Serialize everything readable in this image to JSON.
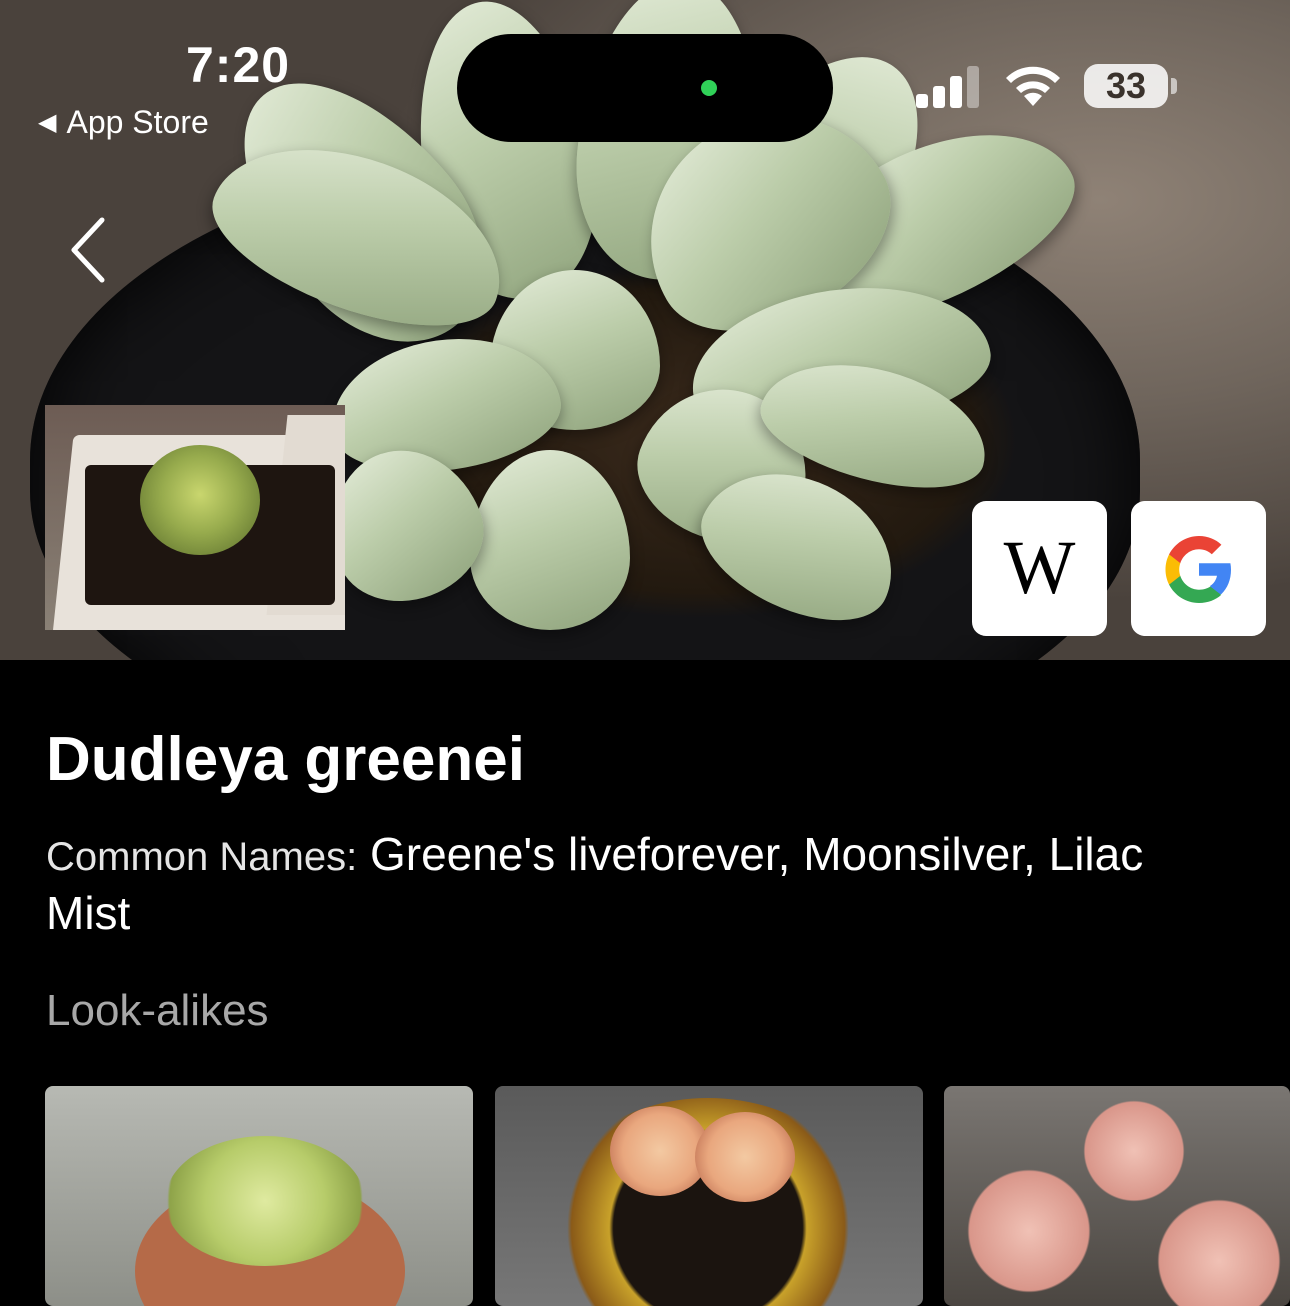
{
  "status_bar": {
    "time": "7:20",
    "back_app_label": "App Store",
    "battery_level": "33"
  },
  "hero": {
    "back_icon": "chevron-left-icon",
    "wikipedia_button_label": "W",
    "google_button_icon": "google-g-icon"
  },
  "plant": {
    "scientific_name": "Dudleya greenei",
    "common_names_label": "Common Names:",
    "common_names_value": "Greene's liveforever, Moonsilver, Lilac Mist"
  },
  "lookalikes": {
    "heading": "Look-alikes",
    "count_visible": 3
  },
  "colors": {
    "background": "#000000",
    "status_green": "#30d158",
    "heading_gray": "#a8a8a8"
  }
}
